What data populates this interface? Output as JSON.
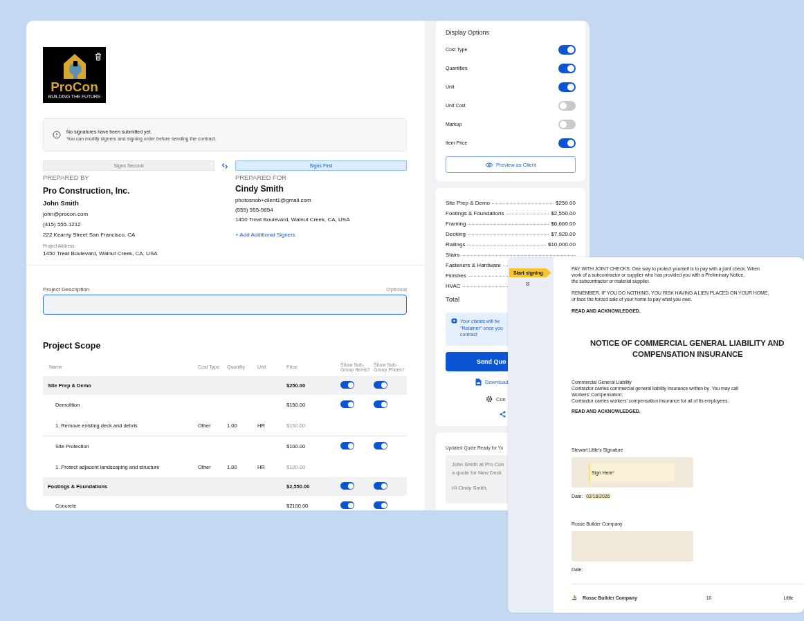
{
  "logo": {
    "name": "ProCon",
    "tagline": "BUILDING THE FUTURE"
  },
  "alert": {
    "title": "No signatures have been submitted yet.",
    "text": "You can modify signers and signing order before sending the contract."
  },
  "parties": [
    {
      "order": "Signs Second",
      "selected": false,
      "heading": "PREPARED BY",
      "company": "Pro Construction, Inc.",
      "person": "John Smith",
      "lines": [
        "john@procon.com",
        "(415) 555-1212",
        "222 Kearny Street San Francisco, CA"
      ],
      "address_label": "Project Address",
      "address": "1450 Treat Boulevard, Walnut Creek, CA, USA"
    },
    {
      "order": "Signs First",
      "selected": true,
      "heading": "PREPARED FOR",
      "company": "Cindy Smith",
      "lines": [
        "photosnob+client1@gmail.com",
        "(555) 555-9854",
        "1450 Treat Boulevard, Walnut Creek, CA, USA"
      ],
      "link": "+ Add Additional Signers"
    }
  ],
  "description": {
    "label": "Project Description",
    "hint": "Optional"
  },
  "scope": {
    "title": "Project Scope",
    "columns": [
      "Name",
      "Cost Type",
      "Quantity",
      "Unit",
      "Price",
      "Show Sub-Group Items?",
      "Show Sub-Group Prices?"
    ],
    "rows": [
      {
        "kind": "group",
        "name": "Site Prep & Demo",
        "price": "$250.00",
        "show_items": true,
        "show_prices": true
      },
      {
        "kind": "subgroup",
        "name": "Demolition",
        "price": "$150.00",
        "show_items": true,
        "show_prices": true
      },
      {
        "kind": "item",
        "name": "1.  Remove existing deck and debris",
        "cost_type": "Other",
        "quantity": "1.00",
        "unit": "HR",
        "price": "$150.00"
      },
      {
        "kind": "subgroup",
        "name": "Site Protection",
        "price": "$100.00",
        "show_items": true,
        "show_prices": true
      },
      {
        "kind": "item",
        "name": "1.  Protect adjacent landscaping and structure",
        "cost_type": "Other",
        "quantity": "1.00",
        "unit": "HR",
        "price": "$100.00"
      },
      {
        "kind": "group",
        "name": "Footings & Foundations",
        "price": "$2,550.00",
        "show_items": true,
        "show_prices": true
      },
      {
        "kind": "subgroup",
        "name": "Concrete",
        "price": "$2100.00",
        "show_items": true,
        "show_prices": true
      }
    ]
  },
  "display_options": {
    "title": "Display Options",
    "options": [
      {
        "label": "Cost Type",
        "on": true
      },
      {
        "label": "Quantities",
        "on": true
      },
      {
        "label": "Unit",
        "on": true
      },
      {
        "label": "Unit Cost",
        "on": false
      },
      {
        "label": "Markup",
        "on": false
      },
      {
        "label": "Item Price",
        "on": true
      }
    ],
    "button": "Preview as Client"
  },
  "summary": {
    "items": [
      {
        "name": "Site Prep & Demo",
        "amount": "$250.00"
      },
      {
        "name": "Footings & Foundations",
        "amount": "$2,550.00"
      },
      {
        "name": "Framing",
        "amount": "$6,660.00"
      },
      {
        "name": "Decking",
        "amount": "$7,920.00"
      },
      {
        "name": "Railings",
        "amount": "$10,000.00"
      },
      {
        "name": "Stairs"
      },
      {
        "name": "Fasteners & Hardware"
      },
      {
        "name": "Finishes"
      },
      {
        "name": "HVAC"
      }
    ],
    "total_label": "Total"
  },
  "note": [
    "Your clients will be",
    "\"Retainer\" once you",
    "contract"
  ],
  "actions": {
    "send": "Send Quo",
    "download": "Download",
    "settings": "Con"
  },
  "email": {
    "title": "Updated Quote Ready for Yo",
    "body": [
      "John Smith at Pro Con",
      "a quote for New Deck"
    ],
    "greeting": "Hi Cindy Smith,"
  },
  "document": {
    "tab": "Start signing",
    "paragraphs": [
      [
        "PAY WITH JOINT CHECKS. One way to protect yourself is to pay with a joint check. When",
        "work of a subcontractor or supplier who has provided you with a Preliminary Notice,",
        "the subcontractor or material supplier."
      ],
      [
        "REMEMBER, IF YOU DO NOTHING, YOU RISK HAVING A LIEN PLACED ON YOUR HOME.",
        "or face the forced sale of your home to pay what you owe."
      ],
      [
        "READ AND ACKNOWLEDGED."
      ]
    ],
    "heading": [
      "NOTICE OF COMMERCIAL GENERAL LIABILITY AND",
      "COMPENSATION INSURANCE"
    ],
    "insurance": [
      [
        "Commercial General Liability",
        "Contractor carries commercial general liability insurance written by    .You may call",
        "Workers' Compensation:",
        "Contractor carries workers' compensation insurance for all of its employees."
      ],
      [
        "READ AND ACKNOWLEDGED."
      ]
    ],
    "signatures": [
      {
        "label": "Stewart Little's Signature",
        "sign_here": "Sign Here",
        "required_mark": "*",
        "date_label": "Date:",
        "date": "02/16/2026"
      },
      {
        "label": "Rosse Builder Company",
        "date_label": "Date:"
      }
    ],
    "footer": [
      "Rosse Builder Company",
      "10",
      "Little"
    ]
  }
}
